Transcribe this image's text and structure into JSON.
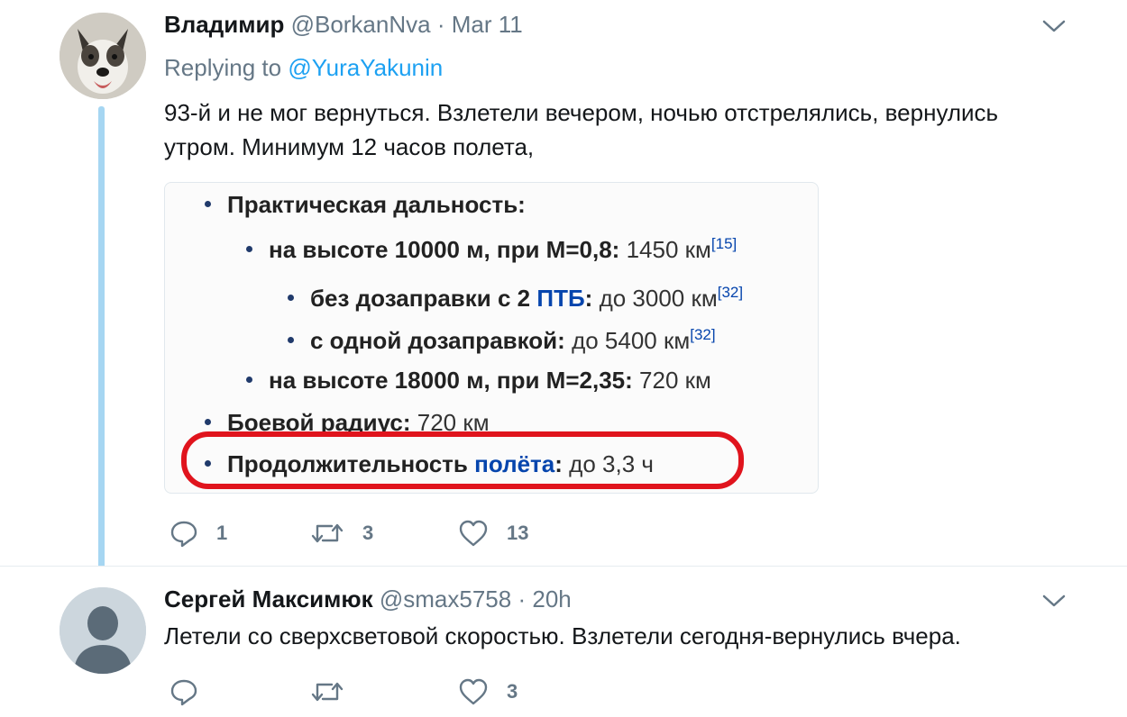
{
  "tweets": [
    {
      "name": "Владимир",
      "handle": "@BorkanNva",
      "separator": "·",
      "time": "Mar 11",
      "replying_label": "Replying to",
      "replying_to": "@YuraYakunin",
      "text": "93-й и не мог вернуться. Взлетели вечером, ночью отстрелялись, вернулись утром. Минимум 12 часов полета,",
      "media": {
        "l1": "Практическая дальность:",
        "l2_bold": "на высоте 10000 м, при М=0,8:",
        "l2_val": "1450 км",
        "l2_ref": "[15]",
        "l3_bold": "без дозаправки с 2",
        "l3_link": "ПТБ",
        "l3_colon": ":",
        "l3_val": "до 3000 км",
        "l3_ref": "[32]",
        "l4_bold": "с одной дозаправкой:",
        "l4_val": "до 5400 км",
        "l4_ref": "[32]",
        "l5_bold": "на высоте 18000 м, при М=2,35:",
        "l5_val": "720 км",
        "l6_bold": "Боевой радиус:",
        "l6_val": "720 км",
        "l7_bold": "Продолжительность",
        "l7_link": "полёта",
        "l7_colon": ":",
        "l7_val": "до 3,3 ч",
        "highlight_color": "#e0141d"
      },
      "replies": "1",
      "retweets": "3",
      "likes": "13"
    },
    {
      "name": "Сергей Максимюк",
      "handle": "@smax5758",
      "separator": "·",
      "time": "20h",
      "text": "Летели со сверхсветовой скоростью. Взлетели сегодня-вернулись вчера.",
      "replies": "",
      "retweets": "",
      "likes": "3"
    }
  ],
  "icons": {
    "reply": "reply-icon",
    "retweet": "retweet-icon",
    "like": "heart-icon",
    "caret": "chevron-down-icon"
  },
  "colors": {
    "link": "#1da1f2",
    "secondary_text": "#657786",
    "thread_line": "#a6d6f2",
    "wiki_link": "#0645ad"
  }
}
